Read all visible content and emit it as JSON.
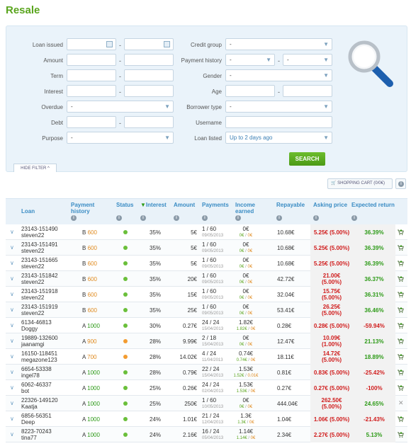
{
  "page_title": "Resale",
  "filter": {
    "loan_issued_label": "Loan issued",
    "amount_label": "Amount",
    "term_label": "Term",
    "interest_label": "Interest",
    "overdue_label": "Overdue",
    "overdue_value": "-",
    "debt_label": "Debt",
    "purpose_label": "Purpose",
    "purpose_value": "-",
    "credit_group_label": "Credit group",
    "credit_group_value": "-",
    "payment_history_label": "Payment history",
    "payment_history_from": "-",
    "payment_history_to": "-",
    "gender_label": "Gender",
    "gender_value": "-",
    "age_label": "Age",
    "borrower_type_label": "Borrower type",
    "borrower_type_value": "-",
    "username_label": "Username",
    "loan_listed_label": "Loan listed",
    "loan_listed_value": "Up to 2 days ago",
    "range_separator": "-",
    "search_button": "SEARCH",
    "hide_filter": "HIDE FILTER"
  },
  "toolbar": {
    "cart_label": "SHOPPING CART (0/0€)"
  },
  "columns": {
    "loan": "Loan",
    "payment_history": "Payment history",
    "status": "Status",
    "interest": "Interest",
    "amount": "Amount",
    "payments": "Payments",
    "income": "Income earned",
    "repayable": "Repayable",
    "asking": "Asking price",
    "expected": "Expected return"
  },
  "colors": {
    "green": "#6abf3a",
    "orange": "#f39c30",
    "accent": "#5aa51e"
  },
  "rows": [
    {
      "id": "23143-151490",
      "user": "steven22",
      "grade": "B",
      "score": "600",
      "score_color": "orange",
      "status": "green",
      "interest": "35%",
      "amount": "5€",
      "payments": "1 / 60",
      "pay_date": "09/05/2013",
      "income": "0€",
      "inc_a": "0€",
      "inc_b": "0€",
      "repayable": "10.68€",
      "ask1": "5.25€ (5.00%)",
      "ask2": "",
      "exp": "36.39%",
      "exp_neg": false,
      "cart": true
    },
    {
      "id": "23143-151491",
      "user": "steven22",
      "grade": "B",
      "score": "600",
      "score_color": "orange",
      "status": "green",
      "interest": "35%",
      "amount": "5€",
      "payments": "1 / 60",
      "pay_date": "09/05/2013",
      "income": "0€",
      "inc_a": "0€",
      "inc_b": "0€",
      "repayable": "10.68€",
      "ask1": "5.25€ (5.00%)",
      "ask2": "",
      "exp": "36.39%",
      "exp_neg": false,
      "cart": true
    },
    {
      "id": "23143-151665",
      "user": "steven22",
      "grade": "B",
      "score": "600",
      "score_color": "orange",
      "status": "green",
      "interest": "35%",
      "amount": "5€",
      "payments": "1 / 60",
      "pay_date": "09/05/2013",
      "income": "0€",
      "inc_a": "0€",
      "inc_b": "0€",
      "repayable": "10.68€",
      "ask1": "5.25€ (5.00%)",
      "ask2": "",
      "exp": "36.39%",
      "exp_neg": false,
      "cart": true
    },
    {
      "id": "23143-151842",
      "user": "steven22",
      "grade": "B",
      "score": "600",
      "score_color": "orange",
      "status": "green",
      "interest": "35%",
      "amount": "20€",
      "payments": "1 / 60",
      "pay_date": "09/05/2013",
      "income": "0€",
      "inc_a": "0€",
      "inc_b": "0€",
      "repayable": "42.72€",
      "ask1": "21.00€",
      "ask2": "(5.00%)",
      "exp": "36.37%",
      "exp_neg": false,
      "cart": true
    },
    {
      "id": "23143-151918",
      "user": "steven22",
      "grade": "B",
      "score": "600",
      "score_color": "orange",
      "status": "green",
      "interest": "35%",
      "amount": "15€",
      "payments": "1 / 60",
      "pay_date": "09/05/2013",
      "income": "0€",
      "inc_a": "0€",
      "inc_b": "0€",
      "repayable": "32.04€",
      "ask1": "15.75€",
      "ask2": "(5.00%)",
      "exp": "36.31%",
      "exp_neg": false,
      "cart": true
    },
    {
      "id": "23143-151919",
      "user": "steven22",
      "grade": "B",
      "score": "600",
      "score_color": "orange",
      "status": "green",
      "interest": "35%",
      "amount": "25€",
      "payments": "1 / 60",
      "pay_date": "09/05/2013",
      "income": "0€",
      "inc_a": "0€",
      "inc_b": "0€",
      "repayable": "53.41€",
      "ask1": "26.25€",
      "ask2": "(5.00%)",
      "exp": "36.46%",
      "exp_neg": false,
      "cart": true
    },
    {
      "id": "6134-46813",
      "user": "Doggy",
      "grade": "A",
      "score": "1000",
      "score_color": "green",
      "status": "green",
      "interest": "30%",
      "amount": "0.27€",
      "payments": "24 / 24",
      "pay_date": "15/04/2013",
      "income": "1.82€",
      "inc_a": "1.82€",
      "inc_b": "0€",
      "repayable": "0.28€",
      "ask1": "0.28€ (5.00%)",
      "ask2": "",
      "exp": "-59.94%",
      "exp_neg": true,
      "cart": true
    },
    {
      "id": "19889-132600",
      "user": "jaanamgi",
      "grade": "A",
      "score": "900",
      "score_color": "orange",
      "status": "orange",
      "interest": "28%",
      "amount": "9.99€",
      "payments": "2 / 18",
      "pay_date": "15/04/2013",
      "income": "0€",
      "inc_a": "0€",
      "inc_b": "0€",
      "repayable": "12.47€",
      "ask1": "10.09€",
      "ask2": "(1.00%)",
      "exp": "21.13%",
      "exp_neg": false,
      "cart": true
    },
    {
      "id": "16150-118451",
      "user": "megazone123",
      "grade": "A",
      "score": "700",
      "score_color": "orange",
      "status": "orange",
      "interest": "28%",
      "amount": "14.02€",
      "payments": "4 / 24",
      "pay_date": "11/04/2013",
      "income": "0.74€",
      "inc_a": "0.74€",
      "inc_b": "0€",
      "repayable": "18.11€",
      "ask1": "14.72€",
      "ask2": "(5.00%)",
      "exp": "18.89%",
      "exp_neg": false,
      "cart": true
    },
    {
      "id": "6654-53338",
      "user": "ingel78",
      "grade": "A",
      "score": "1000",
      "score_color": "green",
      "status": "green",
      "interest": "28%",
      "amount": "0.79€",
      "payments": "22 / 24",
      "pay_date": "15/04/2013",
      "income": "1.53€",
      "inc_a": "1.52€",
      "inc_b": "0.01€",
      "repayable": "0.81€",
      "ask1": "0.83€ (5.00%)",
      "ask2": "",
      "exp": "-25.42%",
      "exp_neg": true,
      "cart": true
    },
    {
      "id": "6062-46337",
      "user": "bot",
      "grade": "A",
      "score": "1000",
      "score_color": "green",
      "status": "green",
      "interest": "25%",
      "amount": "0.26€",
      "payments": "24 / 24",
      "pay_date": "02/04/2013",
      "income": "1.53€",
      "inc_a": "1.53€",
      "inc_b": "0€",
      "repayable": "0.27€",
      "ask1": "0.27€ (5.00%)",
      "ask2": "",
      "exp": "-100%",
      "exp_neg": true,
      "cart": true
    },
    {
      "id": "22326-149120",
      "user": "Kaatja",
      "grade": "A",
      "score": "1000",
      "score_color": "green",
      "status": "green",
      "interest": "25%",
      "amount": "250€",
      "payments": "1 / 60",
      "pay_date": "10/05/2013",
      "income": "0€",
      "inc_a": "0€",
      "inc_b": "0€",
      "repayable": "444.04€",
      "ask1": "262.50€",
      "ask2": "(5.00%)",
      "exp": "24.65%",
      "exp_neg": false,
      "cart": false
    },
    {
      "id": "6856-56351",
      "user": "Deep",
      "grade": "A",
      "score": "1000",
      "score_color": "green",
      "status": "green",
      "interest": "24%",
      "amount": "1.01€",
      "payments": "21 / 24",
      "pay_date": "12/04/2013",
      "income": "1.3€",
      "inc_a": "1.3€",
      "inc_b": "0€",
      "repayable": "1.04€",
      "ask1": "1.06€ (5.00%)",
      "ask2": "",
      "exp": "-21.43%",
      "exp_neg": true,
      "cart": true
    },
    {
      "id": "8223-70243",
      "user": "tina77",
      "grade": "A",
      "score": "1000",
      "score_color": "green",
      "status": "green",
      "interest": "24%",
      "amount": "2.16€",
      "payments": "16 / 24",
      "pay_date": "05/04/2013",
      "income": "1.14€",
      "inc_a": "1.14€",
      "inc_b": "0€",
      "repayable": "2.34€",
      "ask1": "2.27€ (5.00%)",
      "ask2": "",
      "exp": "5.13%",
      "exp_neg": false,
      "cart": true
    }
  ]
}
